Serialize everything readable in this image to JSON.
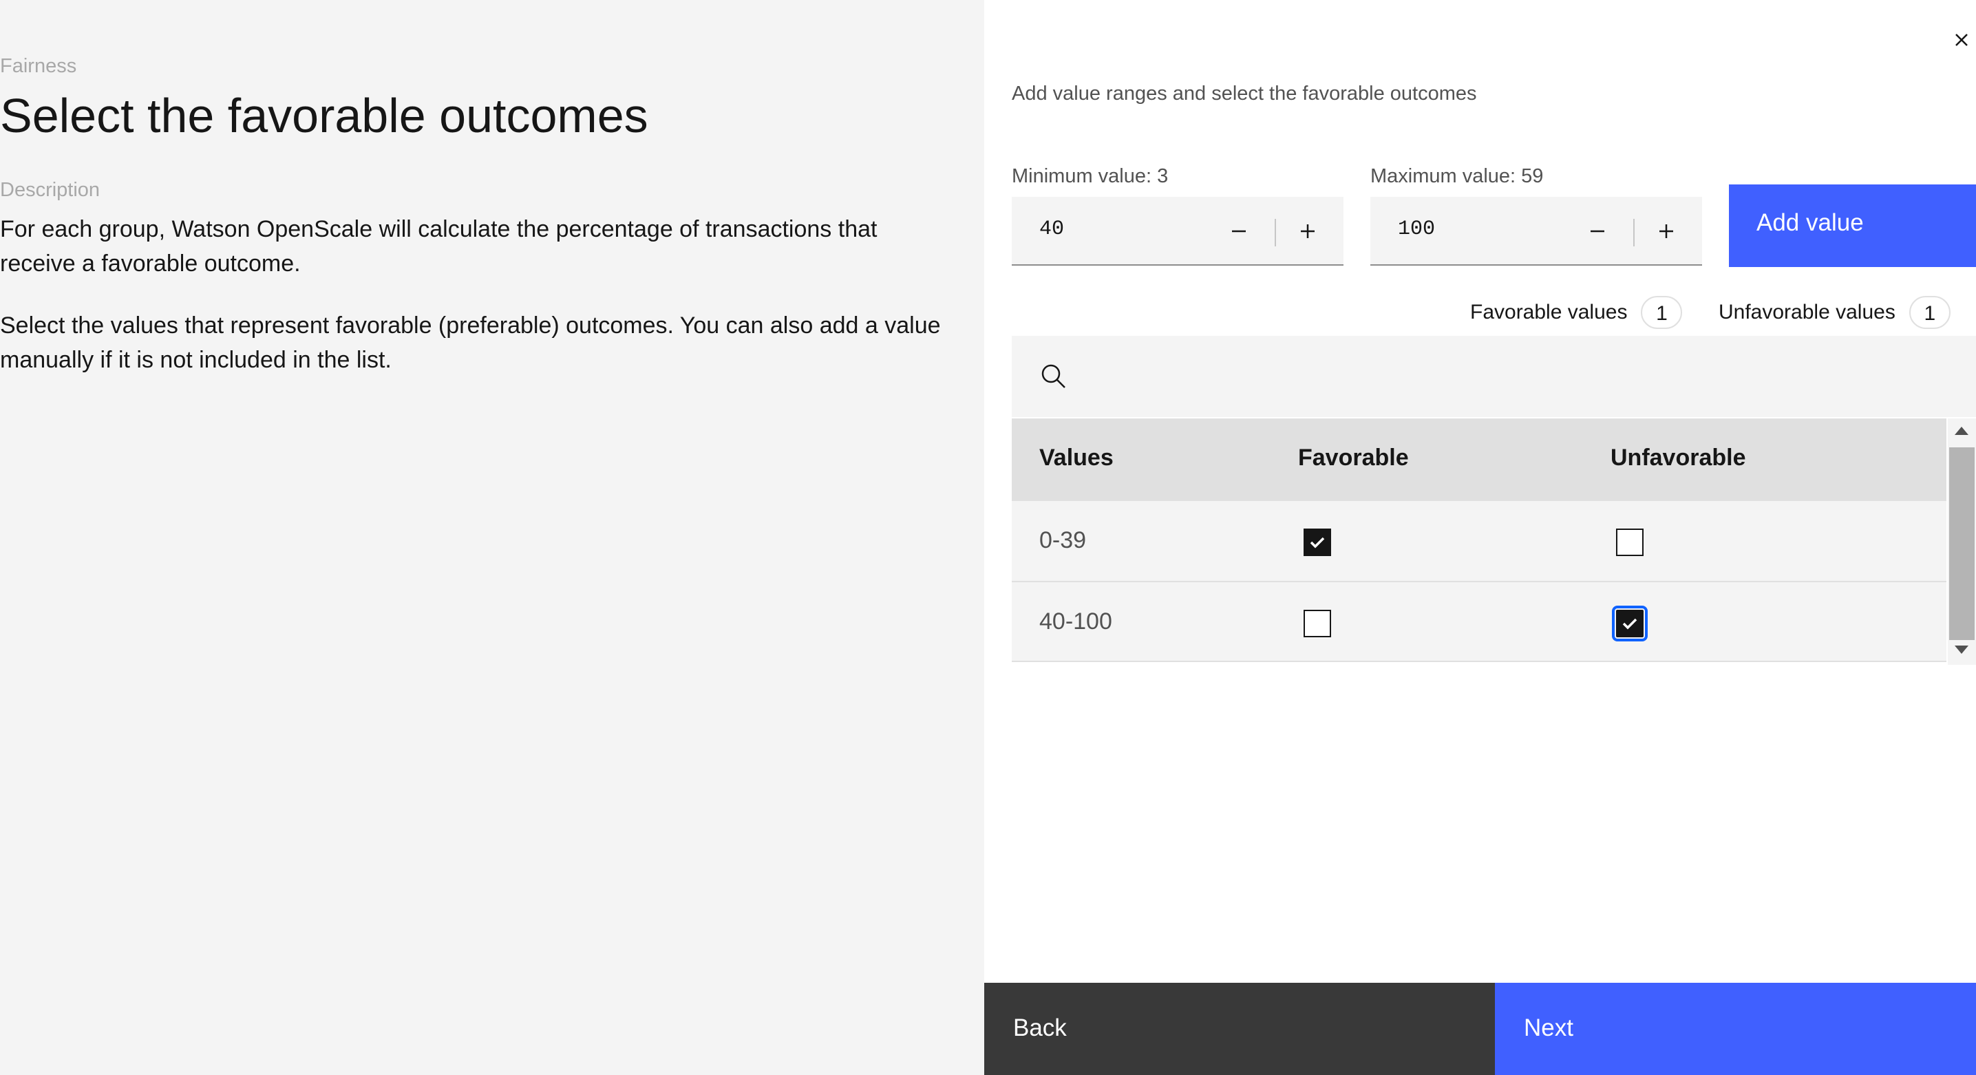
{
  "left": {
    "eyebrow": "Fairness",
    "title": "Select the favorable outcomes",
    "description_label": "Description",
    "paragraphs": [
      "For each group, Watson OpenScale will calculate the percentage of transactions that receive a favorable outcome.",
      "Select the values that represent favorable (preferable) outcomes. You can also add a value manually if it is not included in the list."
    ]
  },
  "panel": {
    "instruction": "Add value ranges and select the favorable outcomes",
    "min_field": {
      "label": "Minimum value: 3",
      "value": "40"
    },
    "max_field": {
      "label": "Maximum value: 59",
      "value": "100"
    },
    "add_button": "Add value",
    "favorable_count": {
      "label": "Favorable values",
      "count": "1"
    },
    "unfavorable_count": {
      "label": "Unfavorable values",
      "count": "1"
    },
    "search": {
      "placeholder": ""
    },
    "table": {
      "headers": [
        "Values",
        "Favorable",
        "Unfavorable"
      ],
      "rows": [
        {
          "value": "0-39",
          "favorable": true,
          "unfavorable": false
        },
        {
          "value": "40-100",
          "favorable": false,
          "unfavorable": true
        }
      ]
    }
  },
  "footer": {
    "back": "Back",
    "next": "Next"
  },
  "colors": {
    "primary": "#4060ff",
    "dark": "#393939",
    "panel_bg": "#f4f4f4"
  }
}
